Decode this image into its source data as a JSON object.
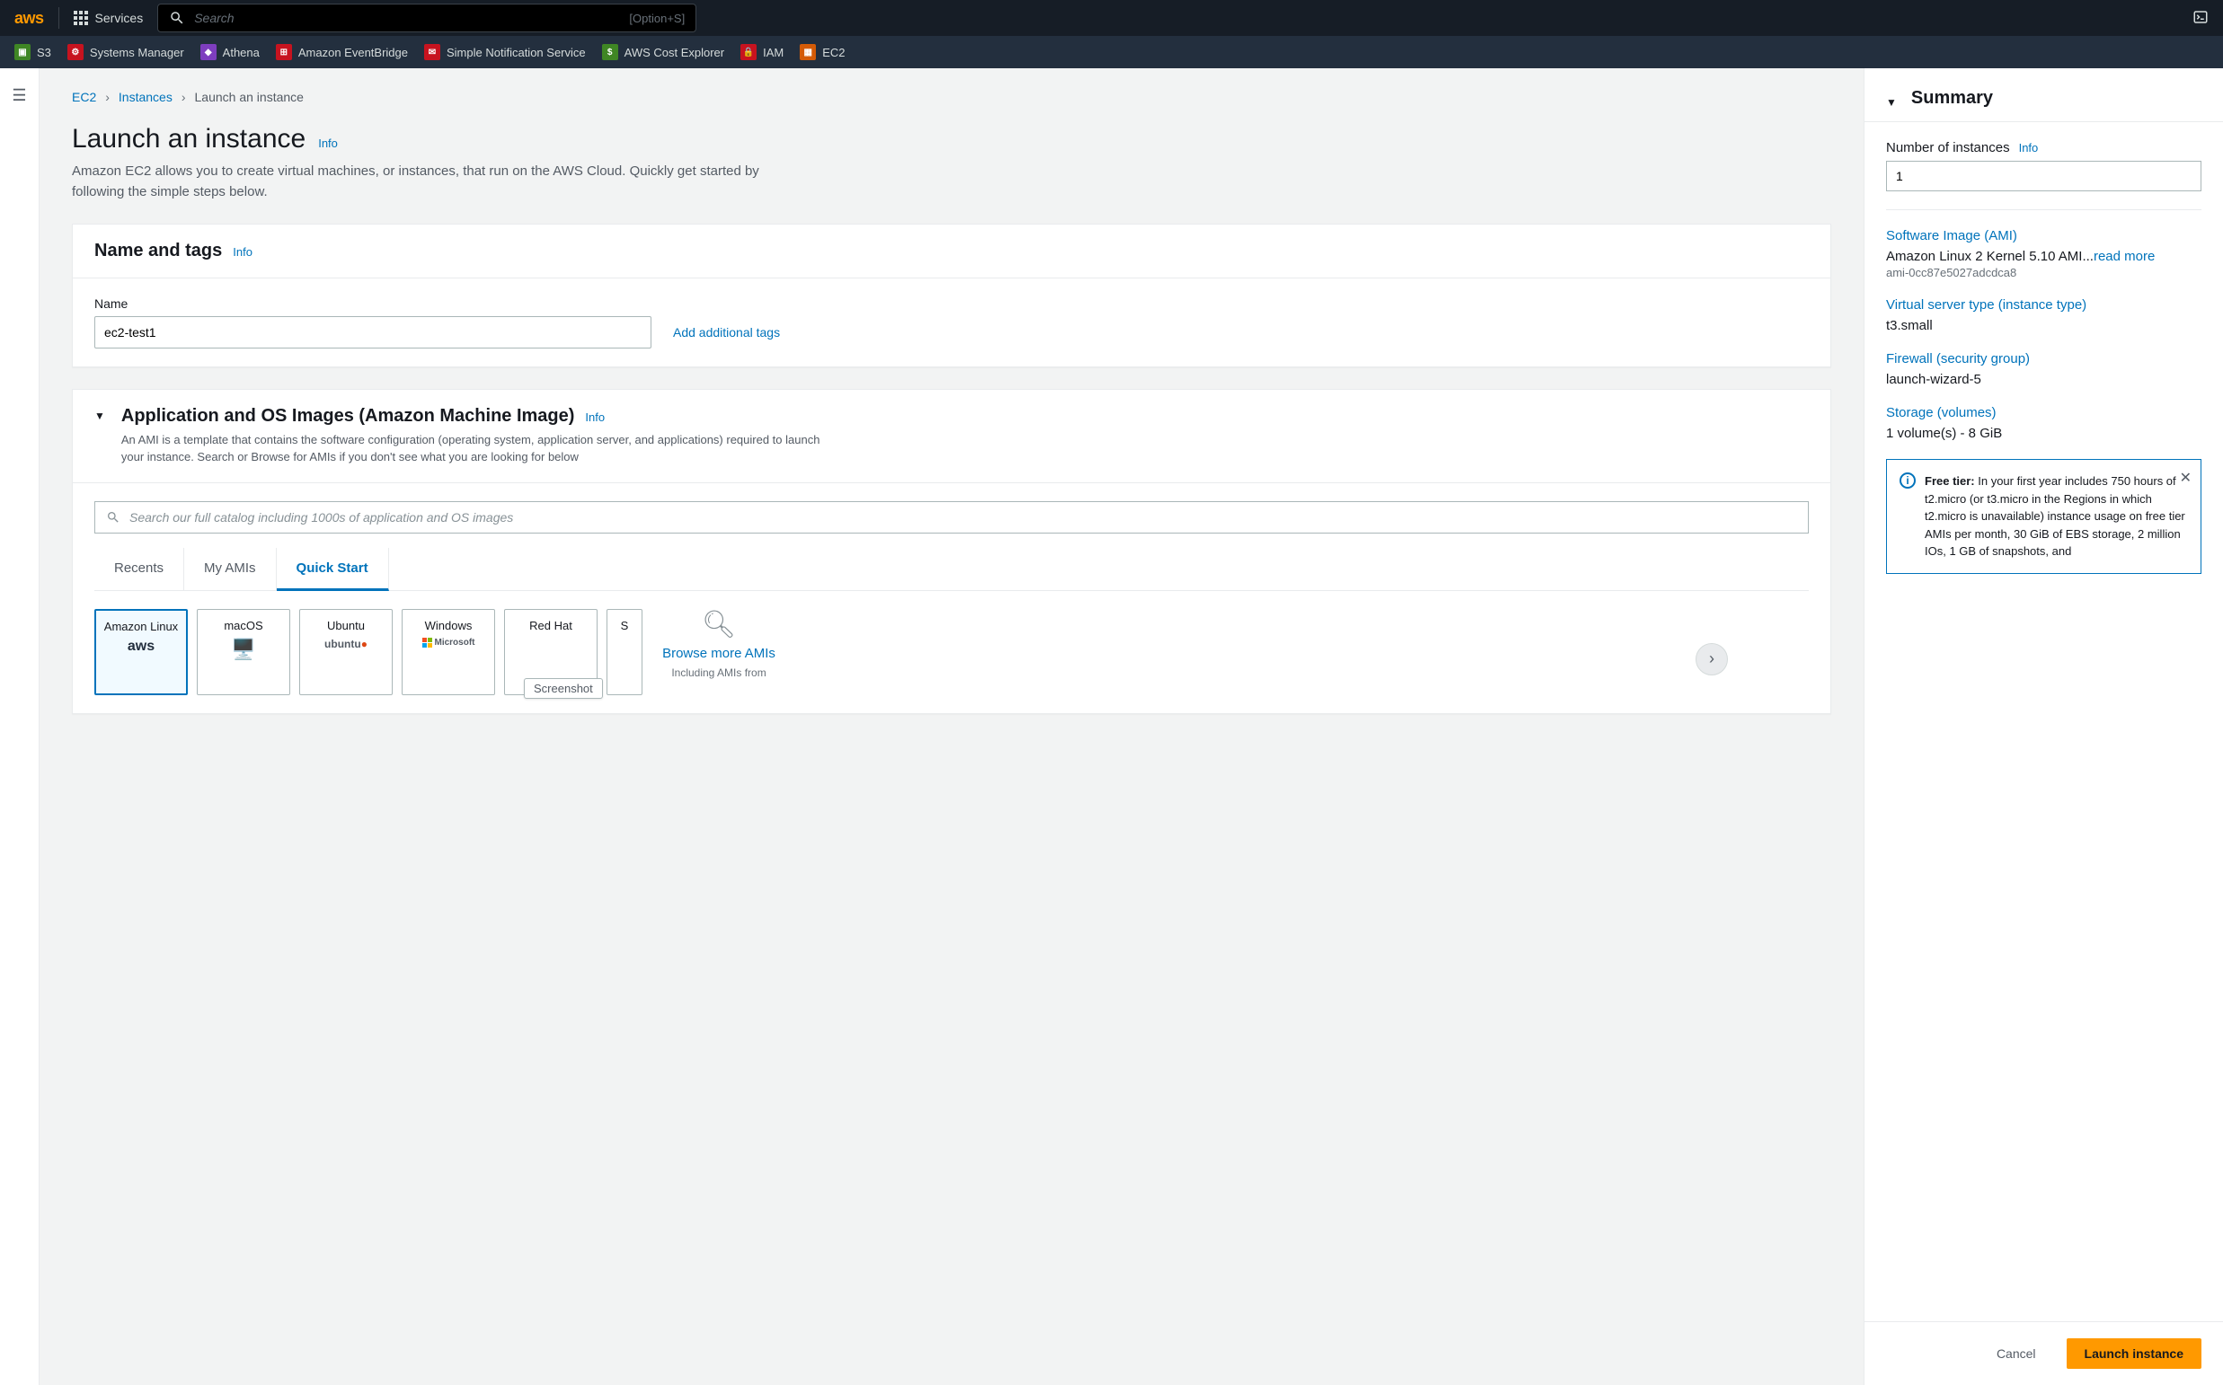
{
  "topnav": {
    "logo": "aws",
    "services_label": "Services",
    "search_placeholder": "Search",
    "search_hint": "[Option+S]"
  },
  "favorites": [
    {
      "label": "S3",
      "color": "#3f8624"
    },
    {
      "label": "Systems Manager",
      "color": "#c7131f"
    },
    {
      "label": "Athena",
      "color": "#7e3ebf"
    },
    {
      "label": "Amazon EventBridge",
      "color": "#c7131f"
    },
    {
      "label": "Simple Notification Service",
      "color": "#c7131f"
    },
    {
      "label": "AWS Cost Explorer",
      "color": "#3f8624"
    },
    {
      "label": "IAM",
      "color": "#c7131f"
    },
    {
      "label": "EC2",
      "color": "#d45b07"
    }
  ],
  "breadcrumb": {
    "items": [
      "EC2",
      "Instances",
      "Launch an instance"
    ]
  },
  "page": {
    "title": "Launch an instance",
    "info": "Info",
    "desc": "Amazon EC2 allows you to create virtual machines, or instances, that run on the AWS Cloud. Quickly get started by following the simple steps below."
  },
  "name_tags": {
    "title": "Name and tags",
    "info": "Info",
    "name_label": "Name",
    "name_value": "ec2-test1",
    "add_tags": "Add additional tags"
  },
  "ami": {
    "title": "Application and OS Images (Amazon Machine Image)",
    "info": "Info",
    "desc": "An AMI is a template that contains the software configuration (operating system, application server, and applications) required to launch your instance. Search or Browse for AMIs if you don't see what you are looking for below",
    "search_placeholder": "Search our full catalog including 1000s of application and OS images",
    "tabs": [
      "Recents",
      "My AMIs",
      "Quick Start"
    ],
    "active_tab": 2,
    "os_options": [
      {
        "name": "Amazon Linux",
        "logo": "aws",
        "selected": true
      },
      {
        "name": "macOS",
        "logo": "🖥️",
        "selected": false
      },
      {
        "name": "Ubuntu",
        "logo": "ubuntu",
        "selected": false
      },
      {
        "name": "Windows",
        "logo": "Microsoft",
        "selected": false
      },
      {
        "name": "Red Hat",
        "logo": "",
        "selected": false
      },
      {
        "name": "S",
        "logo": "",
        "selected": false
      }
    ],
    "browse_more": "Browse more AMIs",
    "browse_sub": "Including AMIs from",
    "screenshot_badge": "Screenshot"
  },
  "summary": {
    "title": "Summary",
    "num_label": "Number of instances",
    "info": "Info",
    "num_value": "1",
    "ami_title": "Software Image (AMI)",
    "ami_value": "Amazon Linux 2 Kernel 5.10 AMI...",
    "ami_readmore": "read more",
    "ami_id": "ami-0cc87e5027adcdca8",
    "type_title": "Virtual server type (instance type)",
    "type_value": "t3.small",
    "firewall_title": "Firewall (security group)",
    "firewall_value": "launch-wizard-5",
    "storage_title": "Storage (volumes)",
    "storage_value": "1 volume(s) - 8 GiB",
    "free_tier_label": "Free tier:",
    "free_tier_text": " In your first year includes 750 hours of t2.micro (or t3.micro in the Regions in which t2.micro is unavailable) instance usage on free tier AMIs per month, 30 GiB of EBS storage, 2 million IOs, 1 GB of snapshots, and",
    "cancel": "Cancel",
    "launch": "Launch instance"
  }
}
